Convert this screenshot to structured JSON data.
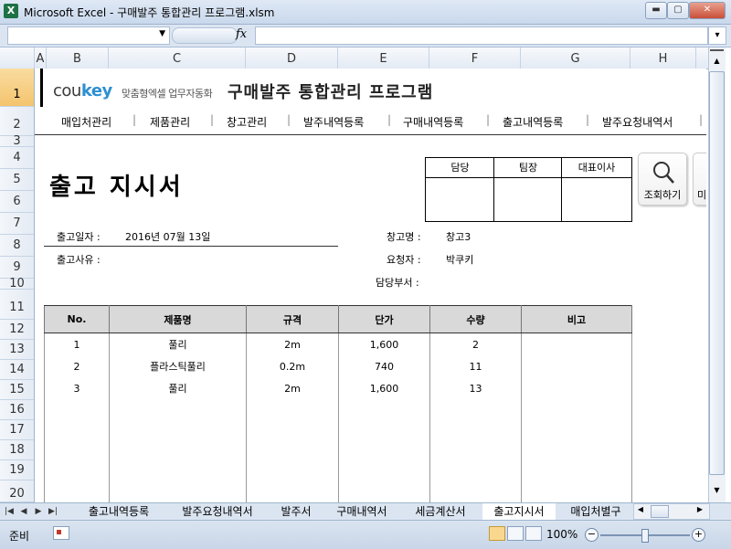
{
  "window": {
    "title": "Microsoft Excel - 구매발주 통합관리 프로그램.xlsm"
  },
  "formula_bar": {
    "fx": "fx",
    "name_box": "",
    "formula": ""
  },
  "columns": [
    "A",
    "B",
    "C",
    "D",
    "E",
    "F",
    "G",
    "H"
  ],
  "rows": [
    "1",
    "2",
    "3",
    "4",
    "5",
    "6",
    "7",
    "8",
    "9",
    "10",
    "11",
    "12",
    "13",
    "14",
    "15",
    "16",
    "17",
    "18",
    "19",
    "20"
  ],
  "header": {
    "brand_cou": "cou",
    "brand_key": "key",
    "brand_sub": "맞춤형엑셀 업무자동화",
    "title": "구매발주 통합관리 프로그램"
  },
  "nav": [
    "매입처관리",
    "제품관리",
    "창고관리",
    "발주내역등록",
    "구매내역등록",
    "출고내역등록",
    "발주요청내역서"
  ],
  "document": {
    "title": "출고 지시서",
    "approval": [
      "담당",
      "팀장",
      "대표이사"
    ],
    "search_button": "조회하기",
    "more_button": "미",
    "date_label": "출고일자 :",
    "date_value": "2016년 07월 13일",
    "reason_label": "출고사유 :",
    "warehouse_label": "창고명 :",
    "warehouse_value": "창고3",
    "requester_label": "요청자 :",
    "requester_value": "박쿠키",
    "dept_label": "담당부서 :"
  },
  "table": {
    "headers": [
      "No.",
      "제품명",
      "규격",
      "단가",
      "수량",
      "비고"
    ],
    "rows": [
      [
        "1",
        "풀리",
        "2m",
        "1,600",
        "2",
        ""
      ],
      [
        "2",
        "플라스틱풀리",
        "0.2m",
        "740",
        "11",
        ""
      ],
      [
        "3",
        "풀리",
        "2m",
        "1,600",
        "13",
        ""
      ]
    ]
  },
  "tabs": [
    "출고내역등록",
    "발주요청내역서",
    "발주서",
    "구매내역서",
    "세금계산서",
    "출고지시서",
    "매입처별구"
  ],
  "active_tab": "출고지시서",
  "status": {
    "ready": "준비",
    "zoom": "100%"
  }
}
